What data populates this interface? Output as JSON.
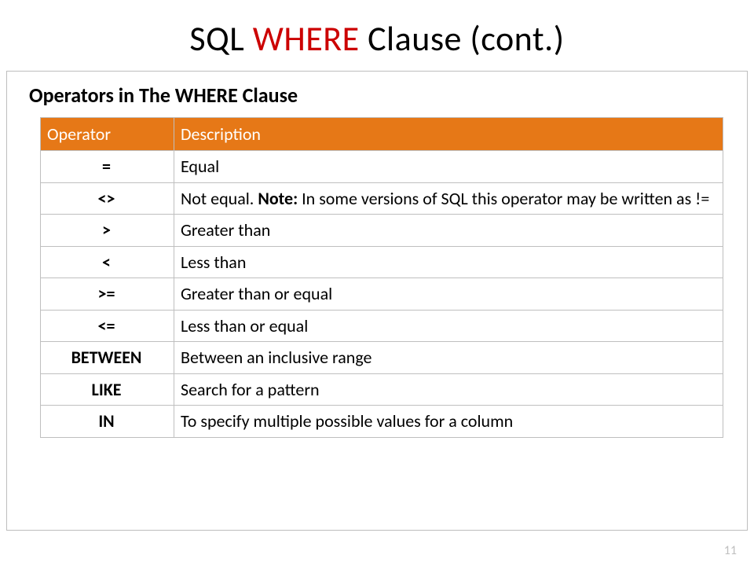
{
  "title": {
    "pre": "SQL ",
    "keyword": "WHERE",
    "post": " Clause (cont.)"
  },
  "subtitle": "Operators in The WHERE Clause",
  "headers": {
    "op": "Operator",
    "desc": "Description"
  },
  "rows": [
    {
      "op": "=",
      "desc": "Equal"
    },
    {
      "op": "<>",
      "desc_pre": "Not equal. ",
      "note_label": "Note:",
      "desc_post": " In some versions of SQL this operator may be written as !="
    },
    {
      "op": ">",
      "desc": "Greater than"
    },
    {
      "op": "<",
      "desc": "Less than"
    },
    {
      "op": ">=",
      "desc": "Greater than or equal"
    },
    {
      "op": "<=",
      "desc": "Less than or equal"
    },
    {
      "op": "BETWEEN",
      "desc": "Between an inclusive range"
    },
    {
      "op": "LIKE",
      "desc": "Search for a pattern"
    },
    {
      "op": "IN",
      "desc": "To specify multiple possible values for a column"
    }
  ],
  "page_number": "11"
}
